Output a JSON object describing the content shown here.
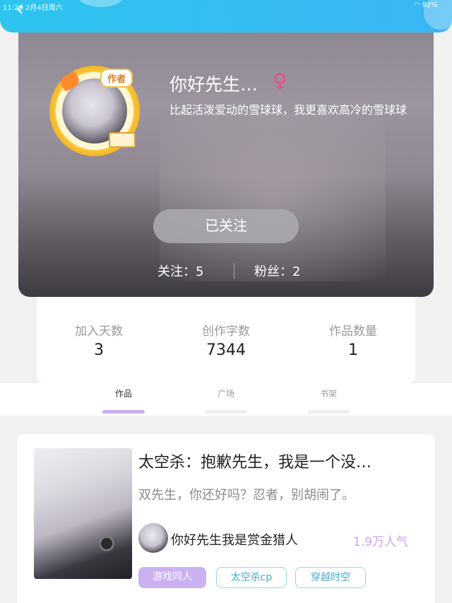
{
  "status_bar": {
    "time": "11:29",
    "date": "2月4日周六",
    "battery": "92%"
  },
  "profile": {
    "author_badge": "作者",
    "nickname": "你好先生…",
    "gender_symbol": "♀",
    "signature": "比起活泼爱动的雪球球，我更喜欢高冷的雪球球",
    "follow_button": "已关注",
    "following": "关注：5",
    "fans": "粉丝：2"
  },
  "stats": [
    {
      "label": "加入天数",
      "value": "3"
    },
    {
      "label": "创作字数",
      "value": "7344"
    },
    {
      "label": "作品数量",
      "value": "1"
    }
  ],
  "tabs": [
    {
      "label": "作品",
      "active": true
    },
    {
      "label": "广场",
      "active": false
    },
    {
      "label": "书架",
      "active": false
    }
  ],
  "work": {
    "title": "太空杀：抱歉先生，我是一个没…",
    "description": "双先生，你还好吗？忍者，别胡闹了。",
    "author": "你好先生我是赏金猎人",
    "popularity": "1.9万人气",
    "tags": [
      "游戏同人",
      "太空杀cp",
      "穿越时空"
    ]
  },
  "colors": {
    "topbar": "#2ec5f0",
    "tab_active": "#c7aef0",
    "gender": "#ee4a8a",
    "popularity": "#c9a6f0"
  }
}
